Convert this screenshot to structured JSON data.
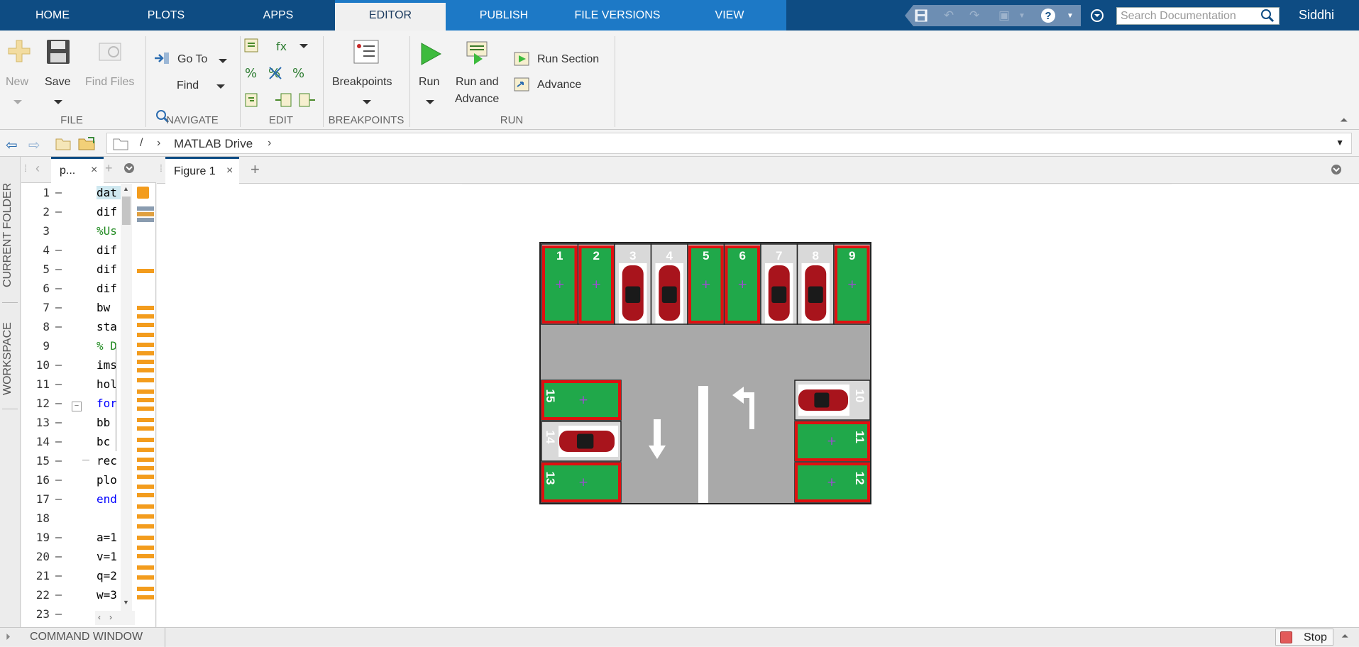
{
  "tabs": [
    "HOME",
    "PLOTS",
    "APPS",
    "EDITOR",
    "PUBLISH",
    "FILE VERSIONS",
    "VIEW"
  ],
  "active_tab": "EDITOR",
  "search": {
    "placeholder": "Search Documentation"
  },
  "user": "Siddhi",
  "ribbon": {
    "file": {
      "new": "New",
      "save": "Save",
      "find_files": "Find Files",
      "group": "FILE"
    },
    "navigate": {
      "goto": "Go To",
      "find": "Find",
      "group": "NAVIGATE"
    },
    "edit": {
      "group": "EDIT"
    },
    "breakpoints": {
      "label": "Breakpoints",
      "group": "BREAKPOINTS"
    },
    "run": {
      "run": "Run",
      "run_advance_1": "Run and",
      "run_advance_2": "Advance",
      "run_section": "Run Section",
      "advance": "Advance",
      "group": "RUN"
    }
  },
  "address": {
    "root": "/",
    "folder": "MATLAB Drive"
  },
  "side_panels": {
    "current_folder": "CURRENT FOLDER",
    "workspace": "WORKSPACE"
  },
  "editor": {
    "tab_label": "p...",
    "lines": [
      {
        "n": "1",
        "dash": "–",
        "code": "dat"
      },
      {
        "n": "2",
        "dash": "–",
        "code": "dif"
      },
      {
        "n": "3",
        "dash": "",
        "code": "%Us"
      },
      {
        "n": "4",
        "dash": "–",
        "code": "dif"
      },
      {
        "n": "5",
        "dash": "–",
        "code": "dif"
      },
      {
        "n": "6",
        "dash": "–",
        "code": "dif"
      },
      {
        "n": "7",
        "dash": "–",
        "code": "bw"
      },
      {
        "n": "8",
        "dash": "–",
        "code": "sta"
      },
      {
        "n": "9",
        "dash": "",
        "code": "% D"
      },
      {
        "n": "10",
        "dash": "–",
        "code": "ims"
      },
      {
        "n": "11",
        "dash": "–",
        "code": "hol"
      },
      {
        "n": "12",
        "dash": "–",
        "code": "for"
      },
      {
        "n": "13",
        "dash": "–",
        "code": "bb"
      },
      {
        "n": "14",
        "dash": "–",
        "code": "bc"
      },
      {
        "n": "15",
        "dash": "–",
        "code": "rec"
      },
      {
        "n": "16",
        "dash": "–",
        "code": "plo"
      },
      {
        "n": "17",
        "dash": "–",
        "code": "end"
      },
      {
        "n": "18",
        "dash": "",
        "code": ""
      },
      {
        "n": "19",
        "dash": "–",
        "code": "a=1"
      },
      {
        "n": "20",
        "dash": "–",
        "code": "v=1"
      },
      {
        "n": "21",
        "dash": "–",
        "code": "q=2"
      },
      {
        "n": "22",
        "dash": "–",
        "code": "w=3"
      },
      {
        "n": "23",
        "dash": "–",
        "code": ""
      }
    ]
  },
  "figure": {
    "tab_label": "Figure 1",
    "top_spots": [
      {
        "label": "1",
        "state": "free"
      },
      {
        "label": "2",
        "state": "free"
      },
      {
        "label": "3",
        "state": "occupied"
      },
      {
        "label": "4",
        "state": "occupied"
      },
      {
        "label": "5",
        "state": "free"
      },
      {
        "label": "6",
        "state": "free"
      },
      {
        "label": "7",
        "state": "occupied"
      },
      {
        "label": "8",
        "state": "occupied"
      },
      {
        "label": "9",
        "state": "free"
      }
    ],
    "left_spots": [
      {
        "label": "15",
        "state": "free"
      },
      {
        "label": "14",
        "state": "occupied"
      },
      {
        "label": "13",
        "state": "free"
      }
    ],
    "right_spots": [
      {
        "label": "10",
        "state": "occupied"
      },
      {
        "label": "11",
        "state": "free"
      },
      {
        "label": "12",
        "state": "free"
      }
    ]
  },
  "command_window": "COMMAND WINDOW",
  "stop_label": "Stop",
  "colors": {
    "topbar": "#0e4c83",
    "tab_highlight": "#1d79c6",
    "free_spot": "#20a84a",
    "spot_border": "#e01010",
    "car": "#a8141c",
    "road": "#a9a9a9",
    "code_orange": "#f39c1d"
  }
}
